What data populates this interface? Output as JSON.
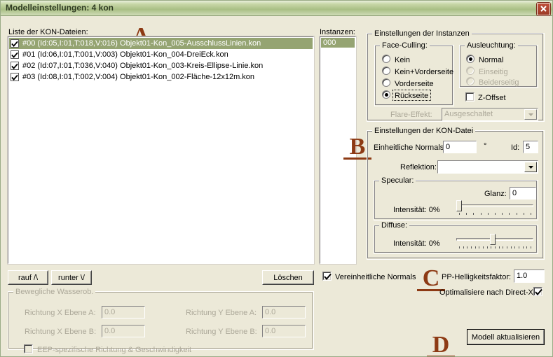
{
  "window": {
    "title": "Modelleinstellungen: 4 kon",
    "close_icon": "close-x-icon",
    "accent_title_color": "#a9bf85",
    "close_button_color": "#b0462f",
    "annotation_color": "#8d3a14",
    "selection_color": "#95a472"
  },
  "annotations": [
    {
      "letter": "A"
    },
    {
      "letter": "B"
    },
    {
      "letter": "C"
    },
    {
      "letter": "D"
    }
  ],
  "kon_list": {
    "label": "Liste der KON-Dateien:",
    "rows": [
      {
        "checked": true,
        "selected": true,
        "text": "#00 (Id:05,I:01,T:018,V:016)   Objekt01-Kon_005-AusschlussLinien.kon"
      },
      {
        "checked": true,
        "selected": false,
        "text": "#01 (Id:06,I:01,T:001,V:003)   Objekt01-Kon_004-DreiEck.kon"
      },
      {
        "checked": true,
        "selected": false,
        "text": "#02 (Id:07,I:01,T:036,V:040)   Objekt01-Kon_003-Kreis-Ellipse-Linie.kon"
      },
      {
        "checked": true,
        "selected": false,
        "text": "#03 (Id:08,I:01,T:002,V:004)   Objekt01-Kon_002-Fläche-12x12m.kon"
      }
    ]
  },
  "list_buttons": {
    "up": "rauf /\\",
    "down": "runter \\/",
    "delete": "Löschen"
  },
  "instances": {
    "label": "Instanzen:",
    "rows": [
      "000"
    ]
  },
  "instance_settings": {
    "caption": "Einstellungen der Instanzen",
    "face_culling": {
      "caption": "Face-Culling:",
      "options": [
        "Kein",
        "Kein+Vorderseite",
        "Vorderseite",
        "Rückseite"
      ],
      "selected": "Rückseite"
    },
    "lighting": {
      "caption": "Ausleuchtung:",
      "options": [
        {
          "label": "Normal",
          "enabled": true
        },
        {
          "label": "Einseitig",
          "enabled": false
        },
        {
          "label": "Beiderseitig",
          "enabled": false
        }
      ],
      "selected": "Normal"
    },
    "z_offset": {
      "label": "Z-Offset",
      "checked": false
    },
    "flare": {
      "label": "Flare-Effekt:",
      "value": "Ausgeschaltet",
      "enabled": false
    }
  },
  "kon_settings": {
    "caption": "Einstellungen der KON-Datei",
    "uniform_normals": {
      "label": "Einheitliche Normals",
      "value": "0",
      "unit": "°"
    },
    "id": {
      "label": "Id:",
      "value": "5"
    },
    "reflection": {
      "label": "Reflektion:",
      "value": ""
    },
    "specular": {
      "caption": "Specular:",
      "gloss_label": "Glanz:",
      "gloss_value": "0",
      "intensity_label": "Intensität: 0%",
      "intensity_percent": 0
    },
    "diffuse": {
      "caption": "Diffuse:",
      "intensity_label": "Intensität: 0%",
      "intensity_percent": 47
    }
  },
  "water": {
    "caption": "Bewegliche Wasserob.",
    "enabled": false,
    "fields": [
      {
        "label": "Richtung X Ebene A:",
        "value": "0.0"
      },
      {
        "label": "Richtung Y Ebene A:",
        "value": "0.0"
      },
      {
        "label": "Richtung X Ebene B:",
        "value": "0.0"
      },
      {
        "label": "Richtung Y Ebene B:",
        "value": "0.0"
      }
    ],
    "eep_checkbox": {
      "label": "EEP-spezifische Richtung & Geschwindigkeit",
      "checked": false
    }
  },
  "footer": {
    "unify_normals": {
      "label": "Vereinheitliche Normals",
      "checked": true
    },
    "pp_brightness": {
      "label": "PP-Helligkeitsfaktor:",
      "value": "1.0"
    },
    "optimize_dx": {
      "label": "Optimalisiere nach Direct-X",
      "checked": true
    },
    "update_button": "Modell aktualisieren"
  }
}
